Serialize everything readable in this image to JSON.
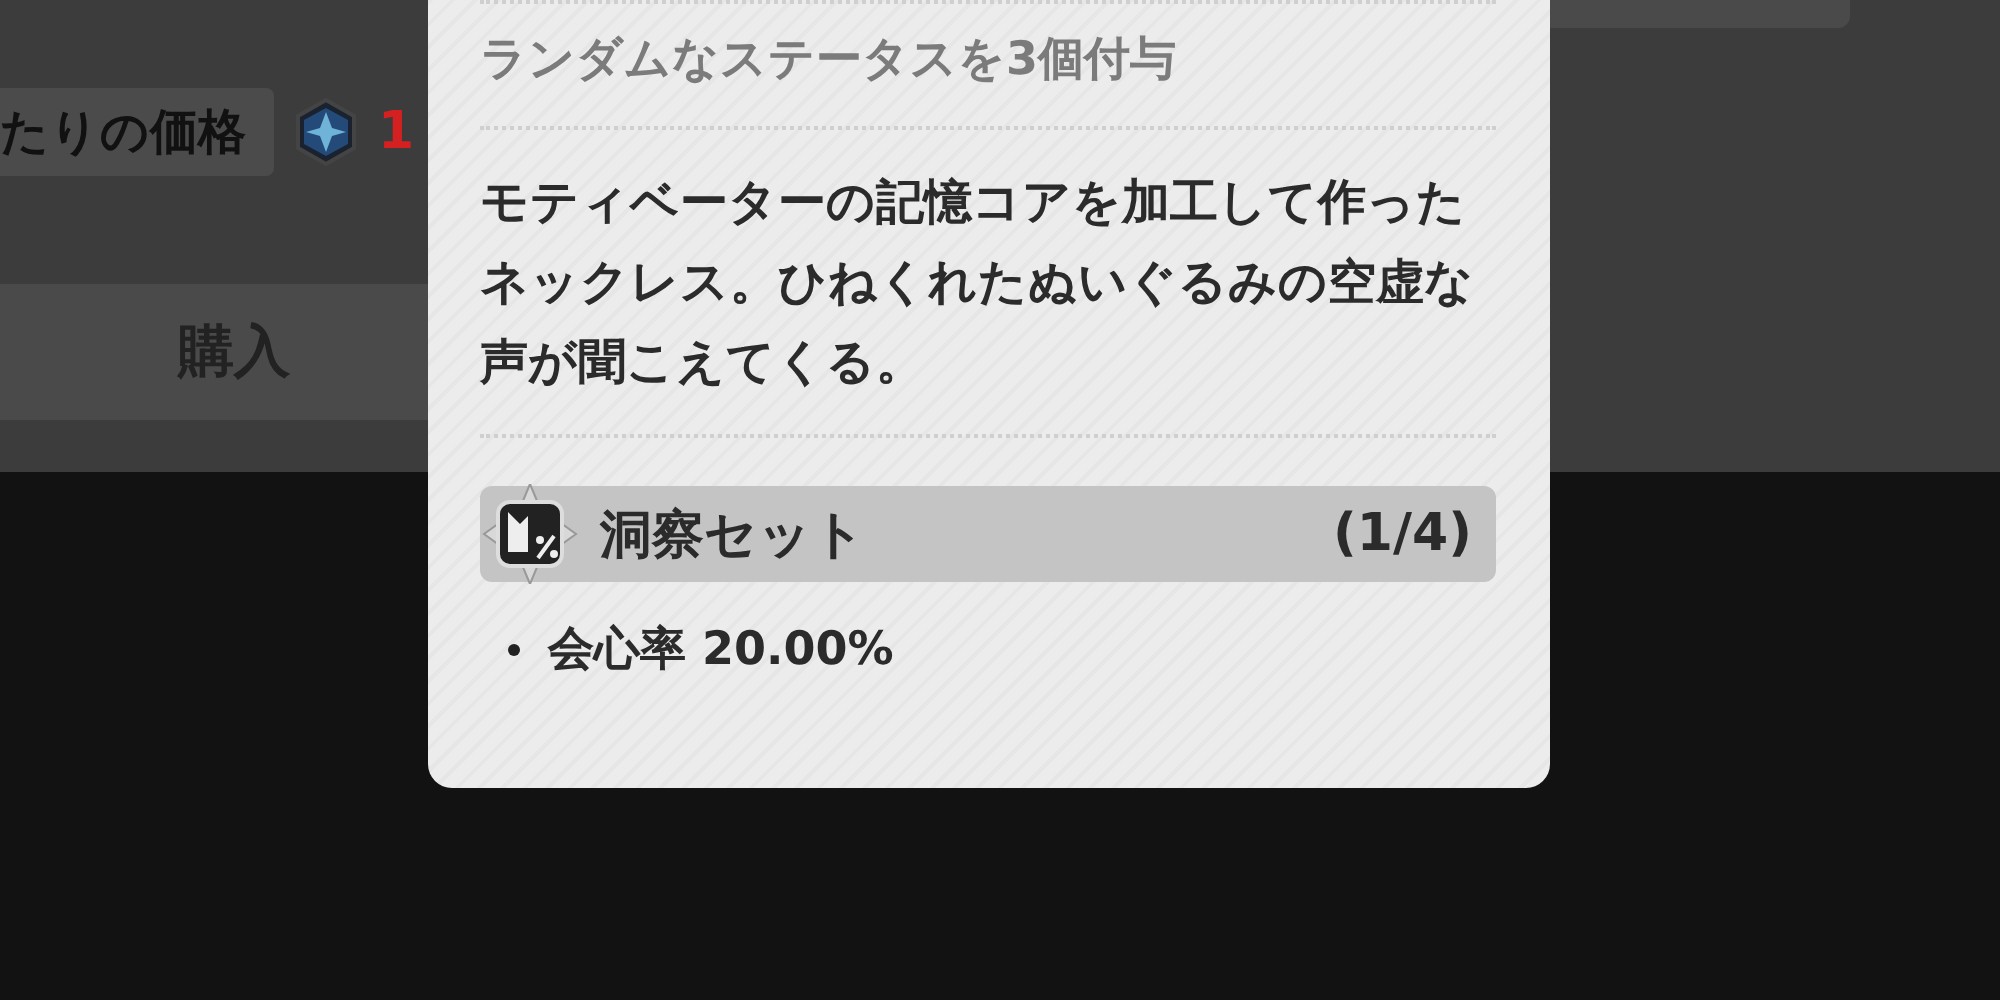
{
  "shop": {
    "price_label": "たりの価格",
    "price_value": "1",
    "buy_button": "購入"
  },
  "tooltip": {
    "stat_line": "ランダムなステータスを3個付与",
    "description": "モティベーターの記憶コアを加工して作ったネックレス。ひねくれたぬいぐるみの空虚な声が聞こえてくる。",
    "set": {
      "name": "洞察セット",
      "count": "(1/4)",
      "bonuses": [
        "会心率 20.00%"
      ]
    }
  }
}
